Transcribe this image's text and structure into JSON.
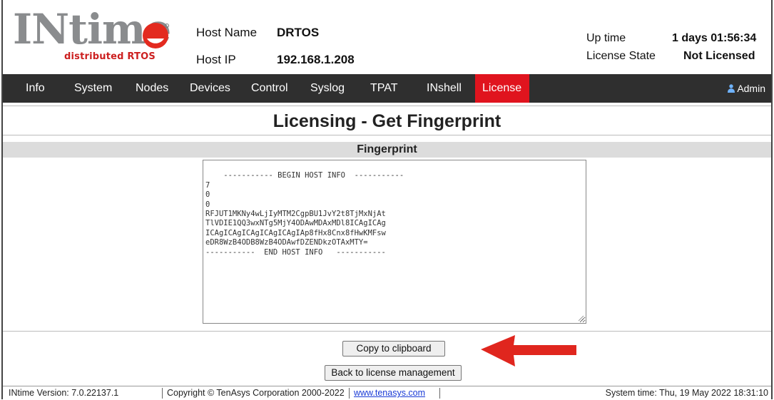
{
  "header": {
    "logo_text": "INtime",
    "logo_tagline": "distributed RTOS",
    "host_name_label": "Host Name",
    "host_name_value": "DRTOS",
    "host_ip_label": "Host IP",
    "host_ip_value": "192.168.1.208",
    "uptime_label": "Up time",
    "uptime_value": "1 days 01:56:34",
    "license_state_label": "License State",
    "license_state_value": "Not Licensed"
  },
  "nav": {
    "items": [
      "Info",
      "System",
      "Nodes",
      "Devices",
      "Control",
      "Syslog",
      "TPAT",
      "INshell",
      "License"
    ],
    "active": "License",
    "user_label": "Admin",
    "active_color": "#e0141e",
    "bar_color": "#2f2f2f"
  },
  "page": {
    "title": "Licensing - Get Fingerprint",
    "section_title": "Fingerprint",
    "fingerprint_text": "----------- BEGIN HOST INFO  -----------\n7\n0\n0\nRFJUT1MKNy4wLjIyMTM2CgpBU1JvY2t8TjMxNjAt\nTlVDIE1QQ3wxNTg5MjY4ODAwMDAxMDl8ICAgICAg\nICAgICAgICAgICAgICAgIAp8fHx8Cnx8fHwKMFsw\neDR8WzB4ODB8WzB4ODAwfDZENDkzOTAxMTY=\n-----------  END HOST INFO   -----------",
    "copy_button": "Copy to clipboard",
    "back_button": "Back to license management",
    "arrow_color": "#e0261e"
  },
  "footer": {
    "version": "INtime Version: 7.0.22137.1",
    "copyright": "Copyright © TenAsys Corporation 2000-2022",
    "link": "www.tenasys.com",
    "system_time": "System time: Thu, 19 May 2022 18:31:10"
  }
}
